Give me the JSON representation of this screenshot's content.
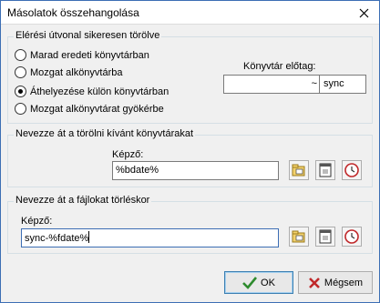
{
  "window": {
    "title": "Másolatok összehangolása"
  },
  "group_delete_path": {
    "legend": "Elérési útvonal sikeresen törölve",
    "options": [
      {
        "label": "Marad eredeti könyvtárban",
        "checked": false
      },
      {
        "label": "Mozgat alkönyvtárba",
        "checked": false
      },
      {
        "label": "Áthelyezése külön könyvtárban",
        "checked": true
      },
      {
        "label": "Mozgat alkönyvtárat gyökérbe",
        "checked": false
      }
    ],
    "prefix_label": "Könyvtár előtag:",
    "prefix_left_value": "~",
    "prefix_right_value": "sync"
  },
  "group_rename_dirs": {
    "legend": "Nevezze át a törölni kívánt könyvtárakat",
    "pattern_label": "Képző:",
    "pattern_value": "%bdate%"
  },
  "group_rename_files": {
    "legend": "Nevezze át a fájlokat törléskor",
    "pattern_label": "Képző:",
    "pattern_value": "sync-%fdate%"
  },
  "buttons": {
    "ok": "OK",
    "cancel": "Mégsem"
  },
  "colors": {
    "accent_border": "#3c6eb4",
    "ok_icon": "#2e8b2e",
    "cancel_icon": "#c0282a"
  }
}
